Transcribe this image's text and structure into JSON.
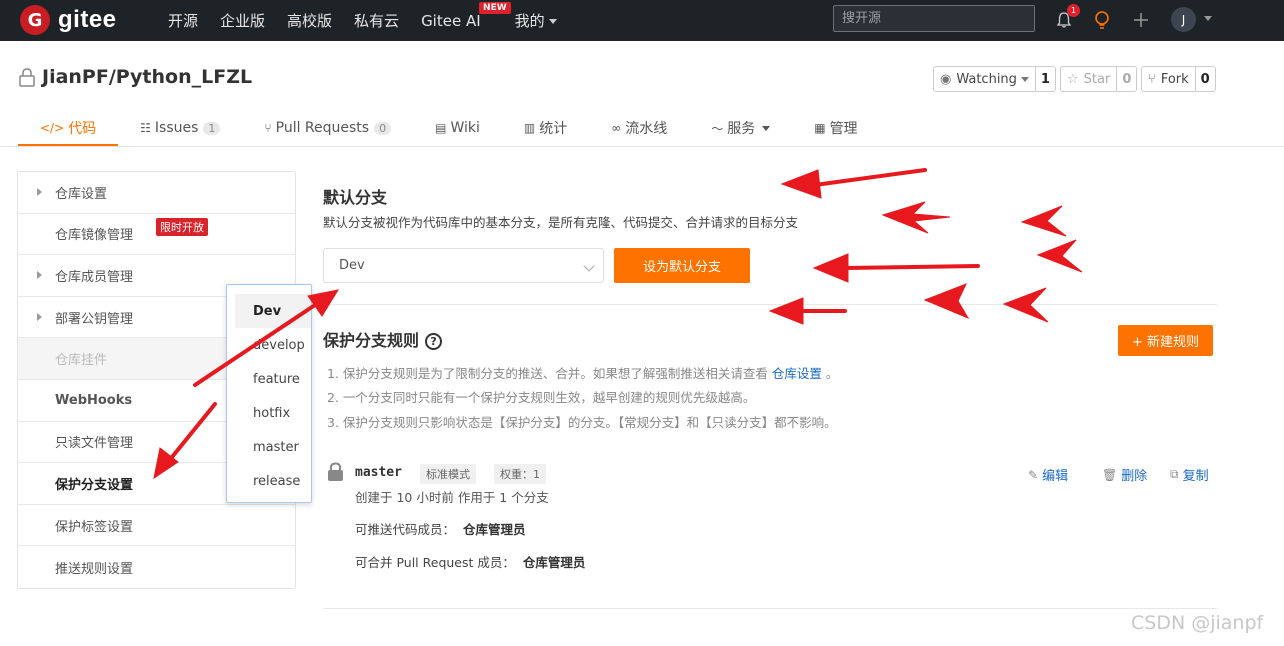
{
  "topnav": {
    "logo_letter": "G",
    "logo_text": "gitee",
    "links": [
      "开源",
      "企业版",
      "高校版",
      "私有云",
      "Gitee AI",
      "我的"
    ],
    "new_badge": "NEW",
    "search_placeholder": "搜开源",
    "bell_count": "1",
    "avatar_letter": "J"
  },
  "repo": {
    "name": "JianPF/Python_LFZL",
    "watching_label": "Watching",
    "watching_count": "1",
    "star_label": "Star",
    "star_count": "0",
    "fork_label": "Fork",
    "fork_count": "0"
  },
  "tabs": [
    {
      "label": "代码",
      "icon": "</>"
    },
    {
      "label": "Issues",
      "count": "1",
      "icon": "☷"
    },
    {
      "label": "Pull Requests",
      "count": "0",
      "icon": "⑂"
    },
    {
      "label": "Wiki",
      "icon": "▤"
    },
    {
      "label": "统计",
      "icon": "▥"
    },
    {
      "label": "流水线",
      "icon": "∞"
    },
    {
      "label": "服务",
      "icon": "〜"
    },
    {
      "label": "管理",
      "icon": "▦"
    }
  ],
  "sidebar": {
    "items": [
      "仓库设置",
      "仓库镜像管理",
      "仓库成员管理",
      "部署公钥管理",
      "仓库挂件",
      "WebHooks",
      "只读文件管理",
      "保护分支设置",
      "保护标签设置",
      "推送规则设置"
    ],
    "limit_badge": "限时开放"
  },
  "dropdown": {
    "options": [
      "Dev",
      "develop",
      "feature",
      "hotfix",
      "master",
      "release"
    ]
  },
  "default_branch": {
    "title": "默认分支",
    "desc": "默认分支被视作为代码库中的基本分支，是所有克隆、代码提交、合并请求的目标分支",
    "selected": "Dev",
    "button": "设为默认分支"
  },
  "protect": {
    "title": "保护分支规则",
    "help": "?",
    "new_button": "+ 新建规则",
    "note1_prefix": "1. 保护分支规则是为了限制分支的推送、合并。如果想了解强制推送相关请查看",
    "note1_link": "仓库设置",
    "note1_suffix": "。",
    "note2": "2. 一个分支同时只能有一个保护分支规则生效，越早创建的规则优先级越高。",
    "note3": "3. 保护分支规则只影响状态是【保护分支】的分支。【常规分支】和【只读分支】都不影响。"
  },
  "rule": {
    "branch": "master",
    "mode": "标准模式",
    "weight": "权重：1",
    "meta": "创建于 10 小时前 作用于 1 个分支",
    "push_label": "可推送代码成员：",
    "push_value": "仓库管理员",
    "merge_label": "可合并 Pull Request 成员：",
    "merge_value": "仓库管理员",
    "edit": "编辑",
    "delete": "删除",
    "copy": "复制"
  },
  "watermark": "CSDN @jianpf",
  "colors": {
    "accent": "#fe7300",
    "arrow": "#e8191e",
    "nav_bg": "#1e2327",
    "link": "#1a6ac7"
  }
}
